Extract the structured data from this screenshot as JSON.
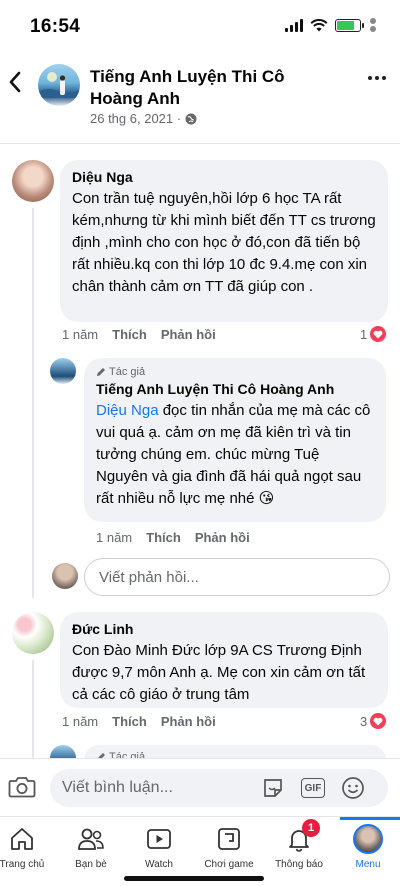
{
  "status_bar": {
    "time": "16:54",
    "battery_percent": 75
  },
  "header": {
    "page_name": "Tiếng Anh Luyện Thi Cô Hoàng Anh",
    "post_date": "26 thg 6, 2021 ·"
  },
  "comments": [
    {
      "author": "Diệu Nga",
      "text": "Con trần tuệ nguyên,hồi lớp 6 học TA rất kém,nhưng từ khi mình biết đến TT cs trương định ,mình cho con học ở đó,con đã tiến bộ rất nhiều.kq con thi lớp 10 đc 9.4.mẹ con xin chân thành cảm ơn TT đã giúp con .",
      "time": "1 năm",
      "like": "Thích",
      "reply": "Phản hồi",
      "reactions": "1"
    },
    {
      "author": "Đức Linh",
      "text": "Con Đào Minh Đức lớp 9A CS Trương Định được 9,7 môn Anh ạ. Mẹ con xin cảm ơn tất cả các cô giáo ở trung tâm",
      "time": "1 năm",
      "like": "Thích",
      "reply": "Phản hồi",
      "reactions": "3"
    }
  ],
  "reply": {
    "author_tag": "Tác giả",
    "author": "Tiếng Anh Luyện Thi Cô Hoàng Anh",
    "mention": "Diệu Nga",
    "text": " đọc tin nhắn của mẹ mà các cô vui quá ạ. cảm ơn mẹ đã kiên trì và tin tưởng chúng em. chúc mừng Tuệ Nguyên và gia đình đã hái quả ngọt sau rất nhiều nỗ lực mẹ nhé 😘",
    "time": "1 năm",
    "like": "Thích",
    "reply": "Phản hồi"
  },
  "reply_input": {
    "placeholder": "Viết phản hồi..."
  },
  "peek_reply": {
    "author_tag": "Tác giả"
  },
  "comment_bar": {
    "placeholder": "Viết bình luận...",
    "gif_label": "GIF"
  },
  "tabs": [
    {
      "label": "Trang chủ",
      "icon": "home-icon"
    },
    {
      "label": "Bạn bè",
      "icon": "friends-icon"
    },
    {
      "label": "Watch",
      "icon": "watch-icon"
    },
    {
      "label": "Chơi game",
      "icon": "gaming-icon"
    },
    {
      "label": "Thông báo",
      "icon": "bell-icon",
      "badge": "1"
    },
    {
      "label": "Menu",
      "icon": "menu-avatar-icon",
      "active": true
    }
  ],
  "colors": {
    "accent": "#1877f2",
    "bubble": "#f0f2f5",
    "badge": "#e41e3f",
    "heart": "#f33e58"
  }
}
